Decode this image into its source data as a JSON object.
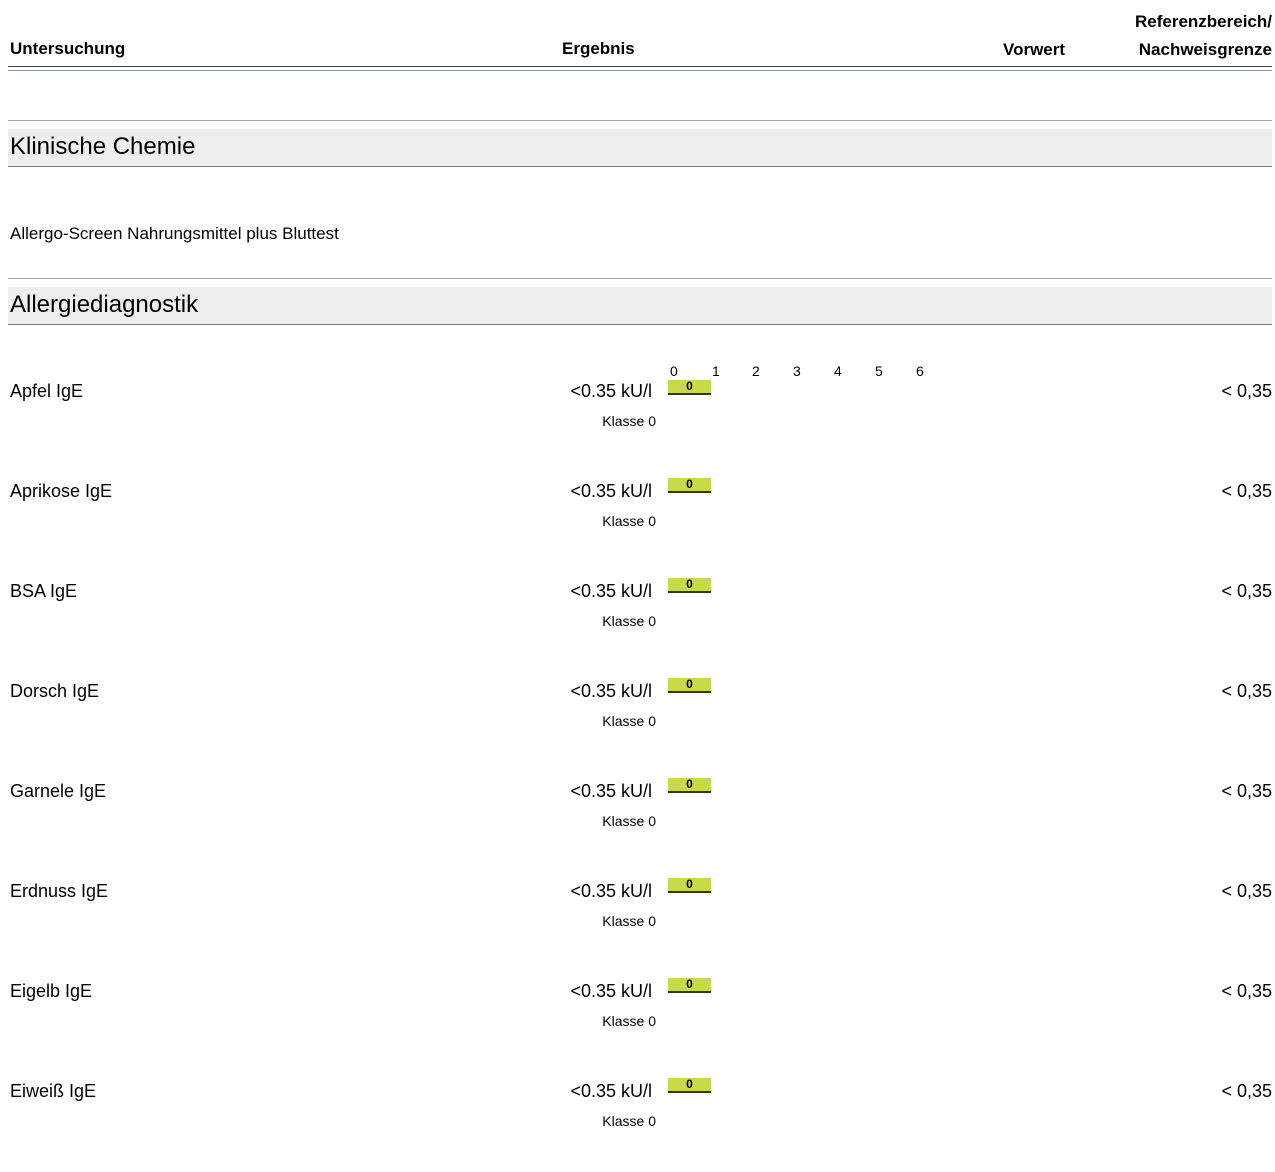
{
  "header": {
    "col_test": "Untersuchung",
    "col_result": "Ergebnis",
    "col_prev": "Vorwert",
    "col_ref_line1": "Referenzbereich/",
    "col_ref_line2": "Nachweisgrenze"
  },
  "sections": {
    "chemistry": "Klinische Chemie",
    "panel": "Allergo-Screen Nahrungsmittel plus Bluttest",
    "allergy": "Allergiediagnostik"
  },
  "scale_labels": [
    "0",
    "1",
    "2",
    "3",
    "4",
    "5",
    "6"
  ],
  "bar_color": "#c8d94a",
  "rows": [
    {
      "name": "Apfel IgE",
      "result": "<0.35 kU/l",
      "class_label": "Klasse 0",
      "class_value": "0",
      "reference": "< 0,35"
    },
    {
      "name": "Aprikose IgE",
      "result": "<0.35 kU/l",
      "class_label": "Klasse 0",
      "class_value": "0",
      "reference": "< 0,35"
    },
    {
      "name": "BSA IgE",
      "result": "<0.35 kU/l",
      "class_label": "Klasse 0",
      "class_value": "0",
      "reference": "< 0,35"
    },
    {
      "name": "Dorsch IgE",
      "result": "<0.35 kU/l",
      "class_label": "Klasse 0",
      "class_value": "0",
      "reference": "< 0,35"
    },
    {
      "name": "Garnele IgE",
      "result": "<0.35 kU/l",
      "class_label": "Klasse 0",
      "class_value": "0",
      "reference": "< 0,35"
    },
    {
      "name": "Erdnuss IgE",
      "result": "<0.35 kU/l",
      "class_label": "Klasse 0",
      "class_value": "0",
      "reference": "< 0,35"
    },
    {
      "name": "Eigelb IgE",
      "result": "<0.35 kU/l",
      "class_label": "Klasse 0",
      "class_value": "0",
      "reference": "< 0,35"
    },
    {
      "name": "Eiweiß IgE",
      "result": "<0.35 kU/l",
      "class_label": "Klasse 0",
      "class_value": "0",
      "reference": "< 0,35"
    }
  ]
}
